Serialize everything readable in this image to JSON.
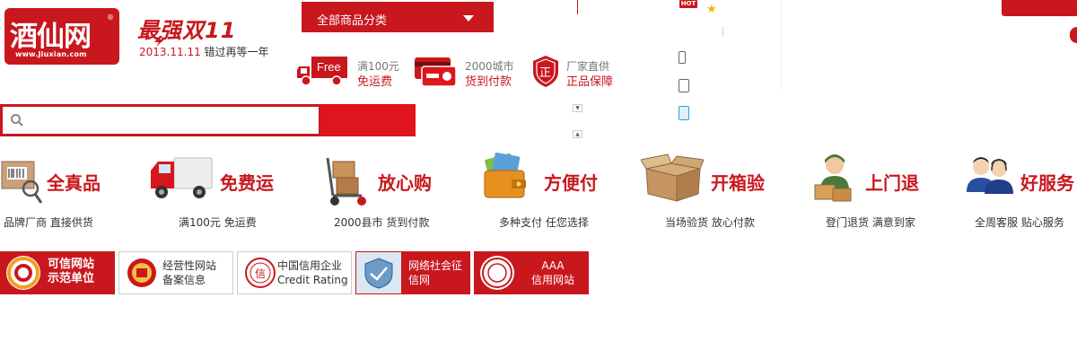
{
  "logo": {
    "name": "酒仙网",
    "url": "www.Jiuxian.com",
    "reg": "®"
  },
  "promo": {
    "title": "最强双11",
    "date": "2013.11.11",
    "tagline": "错过再等一年"
  },
  "category": {
    "label": "全部商品分类"
  },
  "features": [
    {
      "badge": "Free",
      "line1": "满100元",
      "line2": "免运费"
    },
    {
      "line1": "2000城市",
      "line2": "货到付款"
    },
    {
      "badge": "正",
      "line1": "厂家直供",
      "line2": "正品保障"
    }
  ],
  "top_right": {
    "hot": "HOT"
  },
  "search": {
    "placeholder": "",
    "value": ""
  },
  "services": [
    {
      "title": "全真品",
      "desc": "品牌厂商  直接供货"
    },
    {
      "title": "免费运",
      "desc": "满100元  免运费"
    },
    {
      "title": "放心购",
      "desc": "2000县市  货到付款"
    },
    {
      "title": "方便付",
      "desc": "多种支付  任您选择"
    },
    {
      "title": "开箱验",
      "desc": "当场验货  放心付款"
    },
    {
      "title": "上门退",
      "desc": "登门退货  满意到家"
    },
    {
      "title": "好服务",
      "desc": "全周客服  贴心服务"
    }
  ],
  "trust_badges": [
    {
      "line1": "可信网站",
      "line2": "示范单位"
    },
    {
      "line1": "经营性网站",
      "line2": "备案信息"
    },
    {
      "line1": "中国信用企业",
      "line2": "Credit Rating",
      "seal": "信"
    },
    {
      "line1": "网络社会征",
      "line2": "信网"
    },
    {
      "line1": "AAA",
      "line2": "信用网站"
    }
  ],
  "colors": {
    "brand_red": "#c9171e",
    "bright_red": "#e0141c"
  }
}
